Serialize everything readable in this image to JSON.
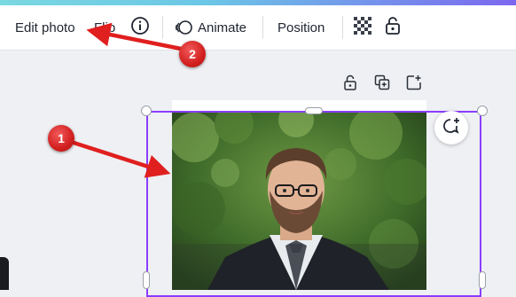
{
  "toolbar": {
    "edit_photo": "Edit photo",
    "flip": "Flip",
    "info_icon": "info-icon",
    "animate_label": "Animate",
    "animate_icon": "animate-icon",
    "position": "Position",
    "transparency_icon": "transparency-icon",
    "lock_icon": "lock-icon"
  },
  "page_tools": {
    "lock_icon": "lock-icon",
    "duplicate_icon": "duplicate-page-icon",
    "add_icon": "add-page-icon"
  },
  "canvas": {
    "comment_icon": "comment-add-icon"
  },
  "callouts": [
    {
      "number": "1"
    },
    {
      "number": "2"
    }
  ],
  "colors": {
    "selection": "#8b3dff",
    "callout_red": "#d21f1f",
    "toolbar_bg": "#ffffff",
    "canvas_bg": "#eef0f3"
  }
}
